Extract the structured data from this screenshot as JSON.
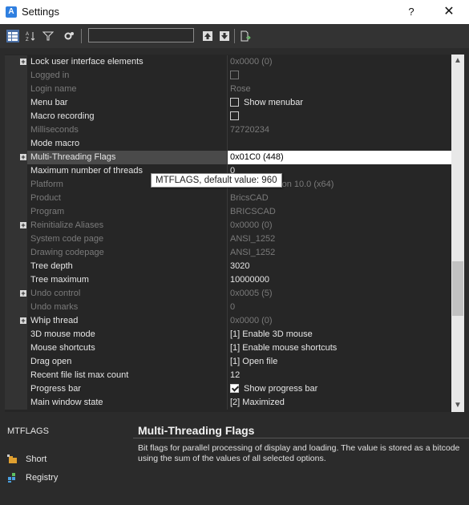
{
  "window": {
    "title": "Settings",
    "help_label": "?",
    "close_label": "✕",
    "app_icon_letter": "A"
  },
  "toolbar": {
    "search_value": "",
    "buttons": [
      "categorized-view-icon",
      "alphabetical-view-icon",
      "filter-icon",
      "settings-icon",
      "move-up-icon",
      "move-down-icon",
      "export-icon"
    ]
  },
  "rows": [
    {
      "name": "Lock user interface elements",
      "value": "0x0000 (0)",
      "expandable": true,
      "dim_value": true
    },
    {
      "name": "Logged in",
      "value": "",
      "checkbox": false,
      "dim": true
    },
    {
      "name": "Login name",
      "value": "Rose",
      "dim": true
    },
    {
      "name": "Menu bar",
      "value": "Show menubar",
      "checkbox": false
    },
    {
      "name": "Macro recording",
      "value": "",
      "checkbox": false
    },
    {
      "name": "Milliseconds",
      "value": "72720234",
      "dim": true
    },
    {
      "name": "Mode macro",
      "value": ""
    },
    {
      "name": "Multi-Threading Flags",
      "value": "0x01C0 (448)",
      "expandable": true,
      "selected": true
    },
    {
      "name": "Maximum number of threads",
      "value": "0"
    },
    {
      "name": "Platform",
      "value": "ows NT Version 10.0 (x64)",
      "dim": true
    },
    {
      "name": "Product",
      "value": "BricsCAD",
      "dim": true
    },
    {
      "name": "Program",
      "value": "BRICSCAD",
      "dim": true
    },
    {
      "name": "Reinitialize Aliases",
      "value": "0x0000 (0)",
      "expandable": true,
      "dim": true
    },
    {
      "name": "System code page",
      "value": "ANSI_1252",
      "dim": true
    },
    {
      "name": "Drawing codepage",
      "value": "ANSI_1252",
      "dim": true
    },
    {
      "name": "Tree depth",
      "value": "3020"
    },
    {
      "name": "Tree maximum",
      "value": "10000000"
    },
    {
      "name": "Undo control",
      "value": "0x0005 (5)",
      "expandable": true,
      "dim": true
    },
    {
      "name": "Undo marks",
      "value": "0",
      "dim": true
    },
    {
      "name": "Whip thread",
      "value": "0x0000 (0)",
      "expandable": true,
      "dim_value": true
    },
    {
      "name": "3D mouse mode",
      "value": "[1] Enable 3D mouse"
    },
    {
      "name": "Mouse shortcuts",
      "value": "[1] Enable mouse shortcuts"
    },
    {
      "name": "Drag open",
      "value": "[1] Open file"
    },
    {
      "name": "Recent file list max count",
      "value": "12"
    },
    {
      "name": "Progress bar",
      "value": "Show progress bar",
      "checkbox": true
    },
    {
      "name": "Main window state",
      "value": "[2] Maximized"
    }
  ],
  "tooltip": "MTFLAGS, default value:  960",
  "details": {
    "variable": "MTFLAGS",
    "title": "Multi-Threading Flags",
    "description": "Bit flags for parallel processing of display and loading. The value is stored as a bitcode using the sum of the values of all selected options.",
    "links": [
      {
        "label": "Short",
        "icon": "short-icon"
      },
      {
        "label": "Registry",
        "icon": "registry-icon"
      }
    ]
  },
  "colors": {
    "background": "#2b2b2b",
    "grid": "#262626",
    "selected_value_bg": "#ffffff",
    "accent": "#2f7fe0"
  }
}
